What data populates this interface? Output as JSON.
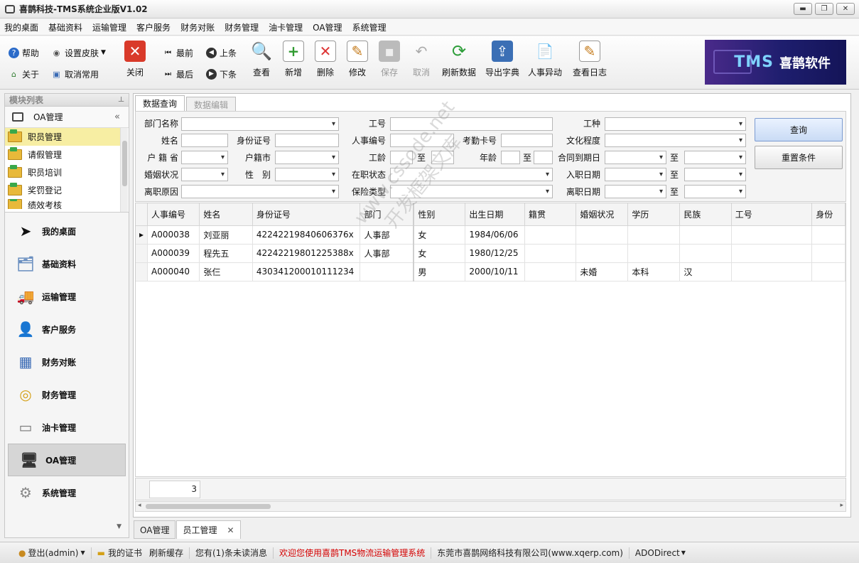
{
  "window": {
    "title": "喜鹊科技-TMS系统企业版V1.02",
    "minimize": "▬",
    "restore": "❐",
    "close": "✕"
  },
  "menu": [
    "我的桌面",
    "基础资料",
    "运输管理",
    "客户服务",
    "财务对账",
    "财务管理",
    "油卡管理",
    "OA管理",
    "系统管理"
  ],
  "toolbar": {
    "help": "帮助",
    "skin": "设置皮肤",
    "about": "关于",
    "cancel_common": "取消常用",
    "close": "关闭",
    "first": "最前",
    "prev": "上条",
    "last": "最后",
    "next": "下条",
    "view": "查看",
    "add": "新增",
    "delete": "删除",
    "edit": "修改",
    "save": "保存",
    "cancel": "取消",
    "refresh": "刷新数据",
    "export": "导出字典",
    "hr_change": "人事异动",
    "log": "查看日志"
  },
  "logo": {
    "brand": "TMS",
    "name": "喜鹊软件"
  },
  "sidebar": {
    "title": "模块列表",
    "group": "OA管理",
    "items": [
      "职员管理",
      "请假管理",
      "职员培训",
      "奖罚登记",
      "绩效考核"
    ],
    "nav": [
      "我的桌面",
      "基础资料",
      "运输管理",
      "客户服务",
      "财务对账",
      "财务管理",
      "油卡管理",
      "OA管理",
      "系统管理"
    ]
  },
  "tabs": {
    "query": "数据查询",
    "edit": "数据编辑"
  },
  "query": {
    "dept": "部门名称",
    "empno": "工号",
    "jobtype": "工种",
    "name": "姓名",
    "idcard": "身份证号",
    "hrno": "人事编号",
    "attend": "考勤卡号",
    "edu": "文化程度",
    "province": "户 籍 省",
    "city": "户籍市",
    "seniority": "工龄",
    "to": "至",
    "age": "年龄",
    "contract_end": "合同到期日",
    "marriage": "婚姻状况",
    "gender": "性　别",
    "status": "在职状态",
    "hire_date": "入职日期",
    "leave_reason": "离职原因",
    "insurance": "保险类型",
    "leave_date": "离职日期",
    "search_btn": "查询",
    "reset_btn": "重置条件"
  },
  "grid": {
    "columns": [
      "人事编号",
      "姓名",
      "身份证号",
      "部门",
      "性别",
      "出生日期",
      "籍贯",
      "婚姻状况",
      "学历",
      "民族",
      "工号",
      "身份"
    ],
    "rows": [
      [
        "A000038",
        "刘亚丽",
        "42242219840606376x",
        "人事部",
        "女",
        "1984/06/06",
        "",
        "",
        "",
        "",
        "",
        ""
      ],
      [
        "A000039",
        "程先五",
        "42242219801225388x",
        "人事部",
        "女",
        "1980/12/25",
        "",
        "",
        "",
        "",
        "",
        ""
      ],
      [
        "A000040",
        "张仨",
        "430341200010111234",
        "",
        "男",
        "2000/10/11",
        "",
        "未婚",
        "本科",
        "汉",
        "",
        ""
      ]
    ],
    "count": "3",
    "row_indicator": "▸"
  },
  "doc_tabs": [
    "OA管理",
    "员工管理"
  ],
  "status": {
    "user": "登出(admin)",
    "cert": "我的证书",
    "refresh": "刷新缓存",
    "msg": "您有(1)条未读消息",
    "welcome": "欢迎您使用喜鹊TMS物流运输管理系统",
    "company": "东莞市喜鹊网络科技有限公司(www.xqerp.com)",
    "conn": "ADODirect"
  },
  "watermark": {
    "line1": "www.cssode.net",
    "line2": "开发框架文库"
  },
  "colors": {
    "accent": "#7b9bd1",
    "selected": "#f7eea3",
    "welcome": "#d40000"
  }
}
